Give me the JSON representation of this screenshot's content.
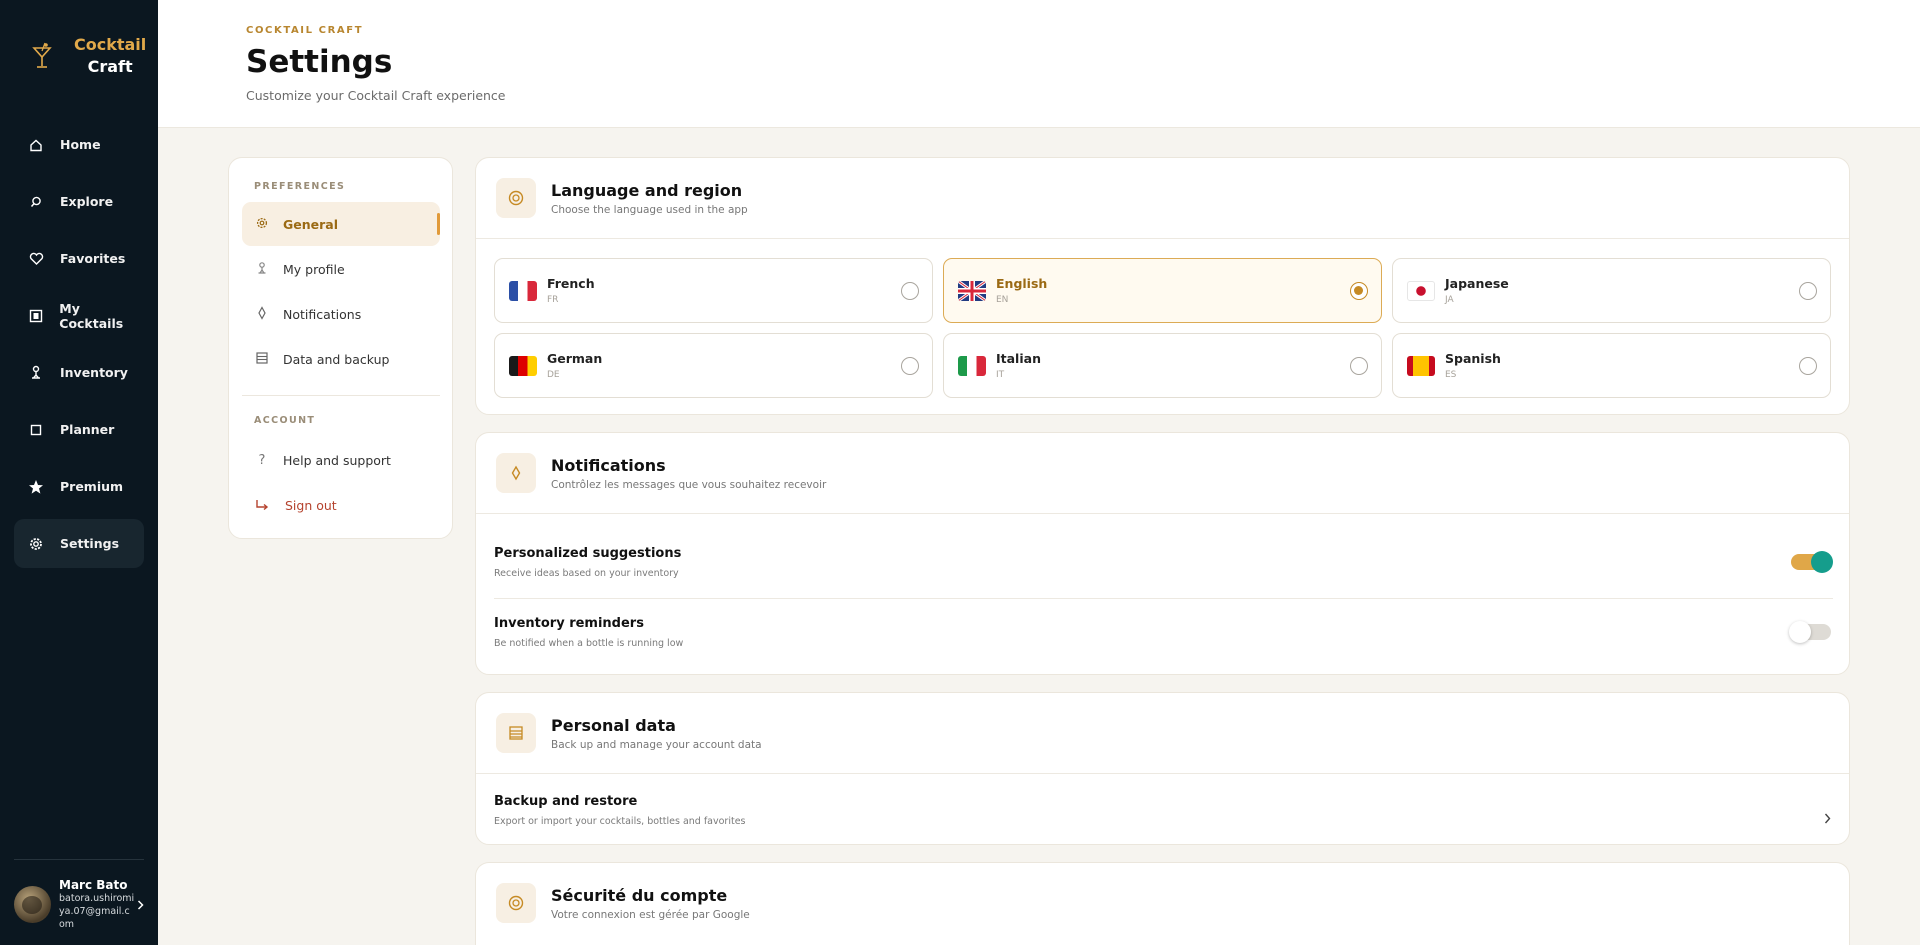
{
  "brand": {
    "line1": "Cocktail",
    "line2": "Craft"
  },
  "nav": {
    "items": [
      {
        "label": "Home",
        "icon": "home-icon"
      },
      {
        "label": "Explore",
        "icon": "search-icon"
      },
      {
        "label": "Favorites",
        "icon": "heart-icon"
      },
      {
        "label": "My Cocktails",
        "icon": "book-icon"
      },
      {
        "label": "Inventory",
        "icon": "bottle-icon"
      },
      {
        "label": "Planner",
        "icon": "calendar-icon"
      },
      {
        "label": "Premium",
        "icon": "star-icon"
      },
      {
        "label": "Settings",
        "icon": "gear-icon"
      }
    ],
    "active": "Settings"
  },
  "user": {
    "name": "Marc Bato",
    "email": "batora.ushiromiya.07@gmail.com"
  },
  "header": {
    "eyebrow": "COCKTAIL CRAFT",
    "title": "Settings",
    "subtitle": "Customize your Cocktail Craft experience"
  },
  "menu": {
    "preferences_heading": "PREFERENCES",
    "account_heading": "ACCOUNT",
    "items": {
      "general": "General",
      "profile": "My profile",
      "notifications": "Notifications",
      "data": "Data and backup",
      "help": "Help and support",
      "signout": "Sign out"
    }
  },
  "language": {
    "title": "Language and region",
    "subtitle": "Choose the language used in the app",
    "selected": "EN",
    "options": [
      {
        "name": "French",
        "code": "FR"
      },
      {
        "name": "English",
        "code": "EN"
      },
      {
        "name": "Japanese",
        "code": "JA"
      },
      {
        "name": "German",
        "code": "DE"
      },
      {
        "name": "Italian",
        "code": "IT"
      },
      {
        "name": "Spanish",
        "code": "ES"
      }
    ]
  },
  "notifications": {
    "title": "Notifications",
    "subtitle": "Contrôlez les messages que vous souhaitez recevoir",
    "rows": [
      {
        "title": "Personalized suggestions",
        "subtitle": "Receive ideas based on your inventory",
        "enabled": true
      },
      {
        "title": "Inventory reminders",
        "subtitle": "Be notified when a bottle is running low",
        "enabled": false
      }
    ]
  },
  "personal_data": {
    "title": "Personal data",
    "subtitle": "Back up and manage your account data",
    "row": {
      "title": "Backup and restore",
      "subtitle": "Export or import your cocktails, bottles and favorites"
    }
  },
  "security": {
    "title": "Sécurité du compte",
    "subtitle": "Votre connexion est gérée par Google"
  },
  "colors": {
    "accent": "#c68a24",
    "sidebar": "#0b1720",
    "toggle_knob": "#159d8c"
  }
}
